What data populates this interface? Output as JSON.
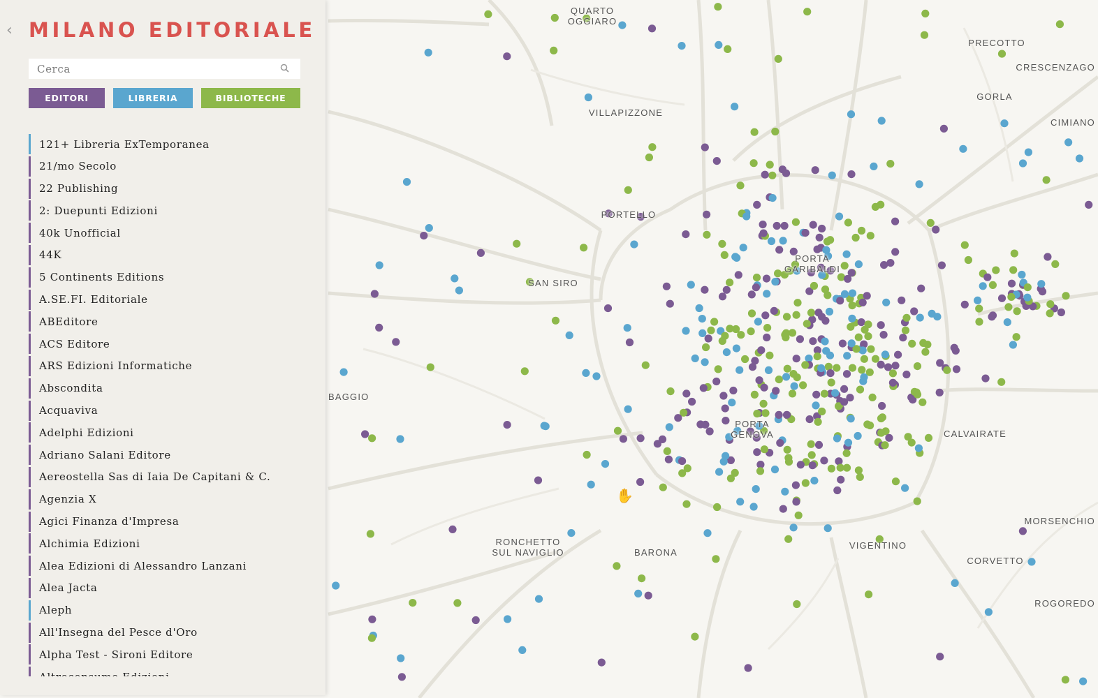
{
  "app": {
    "title": "MILANO EDITORIALE",
    "collapse_glyph": "‹"
  },
  "search": {
    "placeholder": "Cerca",
    "value": ""
  },
  "filters": [
    {
      "id": "editori",
      "label": "EDITORI",
      "color": "#7b5b93"
    },
    {
      "id": "libreria",
      "label": "LIBRERIA",
      "color": "#5aa6cf"
    },
    {
      "id": "biblioteche",
      "label": "BIBLIOTECHE",
      "color": "#8db84a"
    }
  ],
  "list": [
    {
      "label": "121+ Libreria ExTemporanea",
      "type": "libreria"
    },
    {
      "label": "21/mo Secolo",
      "type": "editori"
    },
    {
      "label": "22 Publishing",
      "type": "editori"
    },
    {
      "label": "2: Duepunti Edizioni",
      "type": "editori"
    },
    {
      "label": "40k Unofficial",
      "type": "editori"
    },
    {
      "label": "44K",
      "type": "editori"
    },
    {
      "label": "5 Continents Editions",
      "type": "editori"
    },
    {
      "label": "A.SE.FI. Editoriale",
      "type": "editori"
    },
    {
      "label": "ABEditore",
      "type": "editori"
    },
    {
      "label": "ACS Editore",
      "type": "editori"
    },
    {
      "label": "ARS Edizioni Informatiche",
      "type": "editori"
    },
    {
      "label": "Abscondita",
      "type": "editori"
    },
    {
      "label": "Acquaviva",
      "type": "editori"
    },
    {
      "label": "Adelphi Edizioni",
      "type": "editori"
    },
    {
      "label": "Adriano Salani Editore",
      "type": "editori"
    },
    {
      "label": "Aereostella Sas di Iaia De Capitani & C.",
      "type": "editori"
    },
    {
      "label": "Agenzia X",
      "type": "editori"
    },
    {
      "label": "Agici Finanza d'Impresa",
      "type": "editori"
    },
    {
      "label": "Alchimia Edizioni",
      "type": "editori"
    },
    {
      "label": "Alea Edizioni di Alessandro Lanzani",
      "type": "editori"
    },
    {
      "label": "Alea Jacta",
      "type": "editori"
    },
    {
      "label": "Aleph",
      "type": "libreria"
    },
    {
      "label": "All'Insegna del Pesce d'Oro",
      "type": "editori"
    },
    {
      "label": "Alpha Test - Sironi Editore",
      "type": "editori"
    },
    {
      "label": "Altroconsumo Edizioni",
      "type": "editori"
    }
  ],
  "map": {
    "labels": [
      {
        "text": "QUARTO\nOGGIARO"
      },
      {
        "text": "VILLAPIZZONE"
      },
      {
        "text": "PORTELLO"
      },
      {
        "text": "SAN SIRO"
      },
      {
        "text": "BAGGIO"
      },
      {
        "text": "PORTA\nGARIBALDI"
      },
      {
        "text": "PORTA\nGENOVA"
      },
      {
        "text": "RONCHETTO\nSUL NAVIGLIO"
      },
      {
        "text": "BARONA"
      },
      {
        "text": "VIGENTINO"
      },
      {
        "text": "CALVAIRATE"
      },
      {
        "text": "CORVETTO"
      },
      {
        "text": "PRECOTTO"
      },
      {
        "text": "GORLA"
      },
      {
        "text": "CRESCENZAGO"
      },
      {
        "text": "CIMIANO"
      },
      {
        "text": "MORSENCHIO"
      },
      {
        "text": "ROGOREDO"
      }
    ],
    "marker_colors": {
      "editori": "#7b5b93",
      "libreria": "#5aa6cf",
      "biblioteche": "#8db84a"
    },
    "cursor_icon": "hand-cursor-icon"
  }
}
